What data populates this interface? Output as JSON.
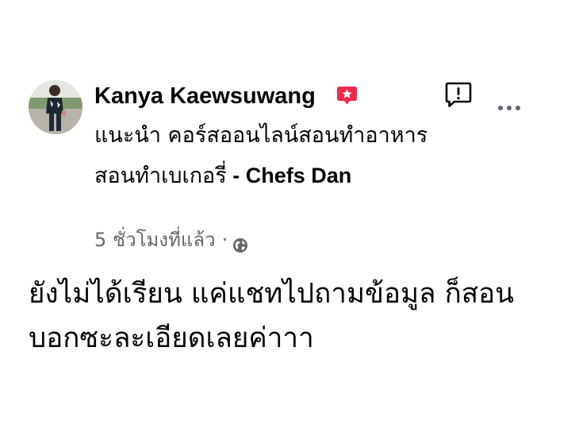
{
  "comment": {
    "author": "Kanya Kaewsuwang",
    "author_badge_icon": "top-fan-star-badge-icon",
    "subtitle_thai": "แนะนำ คอร์สออนไลน์สอนทำอาหาร สอนทำเบเกอรี่",
    "subtitle_separator": " - ",
    "subtitle_brand": "Chefs Dan",
    "time_ago": "5 ชั่วโมงที่แล้ว",
    "meta_separator": "·",
    "privacy_icon": "globe-icon",
    "text": "ยังไม่ได้เรียน แค่แชทไปถามข้อมูล ก็สอนบอกซะละเอียดเลยค่าาา"
  },
  "actions": {
    "report_icon": "report-icon",
    "more_icon": "more-options-icon"
  },
  "colors": {
    "text": "#050505",
    "secondary": "#65676b",
    "badge": "#f02849"
  }
}
